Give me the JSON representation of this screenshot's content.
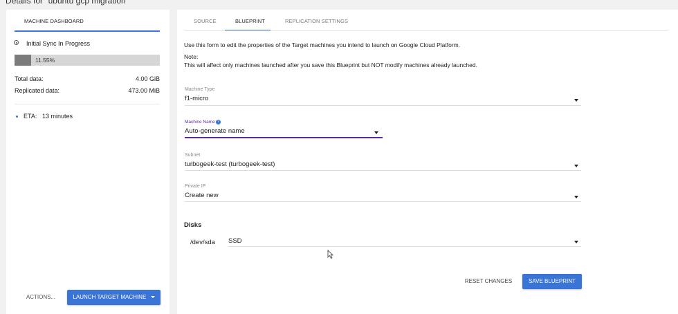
{
  "page": {
    "title": "Details for \"ubuntu gcp migration\""
  },
  "left_panel": {
    "tab_label": "MACHINE DASHBOARD",
    "status": "Initial Sync In Progress",
    "progress_percent": 11.55,
    "progress_label": "11.55%",
    "total_data_label": "Total data:",
    "total_data_value": "4.00 GiB",
    "replicated_label": "Replicated data:",
    "replicated_value": "473.00 MiB",
    "eta_label": "ETA:",
    "eta_value": "13 minutes",
    "actions_label": "ACTIONS...",
    "launch_label": "LAUNCH TARGET MACHINE"
  },
  "tabs": [
    {
      "label": "SOURCE",
      "active": false
    },
    {
      "label": "BLUEPRINT",
      "active": true
    },
    {
      "label": "REPLICATION SETTINGS",
      "active": false
    }
  ],
  "blueprint": {
    "intro": "Use this form to edit the properties of the Target machines you intend to launch on Google Cloud Platform.",
    "note_title": "Note:",
    "note_body": "This will affect only machines launched after you save this Blueprint but NOT modify machines already launched.",
    "machine_type_label": "Machine Type",
    "machine_type_value": "f1-micro",
    "machine_name_label": "Machine Name",
    "machine_name_value": "Auto-generate name",
    "subnet_label": "Subnet",
    "subnet_value": "turbogeek-test (turbogeek-test)",
    "private_ip_label": "Private IP",
    "private_ip_value": "Create new",
    "disks_heading": "Disks",
    "disk_device": "/dev/sda",
    "disk_type": "SSD",
    "reset_label": "RESET CHANGES",
    "save_label": "SAVE BLUEPRINT"
  },
  "colors": {
    "accent": "#3b74d7",
    "focus_purple": "#5b2b9f",
    "progress_fill": "#7b7b7b",
    "progress_track": "#d6d6d6"
  }
}
